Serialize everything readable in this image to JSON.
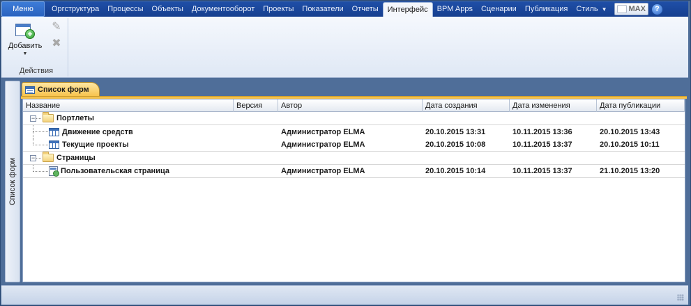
{
  "menubar": {
    "menu_label": "Меню",
    "tabs": [
      {
        "label": "Оргструктура"
      },
      {
        "label": "Процессы"
      },
      {
        "label": "Объекты"
      },
      {
        "label": "Документооборот"
      },
      {
        "label": "Проекты"
      },
      {
        "label": "Показатели"
      },
      {
        "label": "Отчеты"
      },
      {
        "label": "Интерфейс"
      },
      {
        "label": "BPM Apps"
      },
      {
        "label": "Сценарии"
      },
      {
        "label": "Публикация"
      },
      {
        "label": "Стиль"
      }
    ],
    "active_tab": "Интерфейс",
    "max_label": "MAX",
    "help_glyph": "?"
  },
  "ribbon": {
    "add_label": "Добавить",
    "group_label": "Действия"
  },
  "side_panel": {
    "label": "Список форм"
  },
  "document": {
    "tab_label": "Список форм"
  },
  "grid": {
    "columns": [
      "Название",
      "Версия",
      "Автор",
      "Дата создания",
      "Дата изменения",
      "Дата публикации"
    ],
    "groups": [
      {
        "name": "Портлеты",
        "items": [
          {
            "name": "Движение средств",
            "version": "",
            "author": "Администратор ELMA",
            "created": "20.10.2015 13:31",
            "modified": "10.11.2015 13:36",
            "published": "20.10.2015 13:43"
          },
          {
            "name": "Текущие проекты",
            "version": "",
            "author": "Администратор ELMA",
            "created": "20.10.2015 10:08",
            "modified": "10.11.2015 13:37",
            "published": "20.10.2015 10:11"
          }
        ]
      },
      {
        "name": "Страницы",
        "items": [
          {
            "name": "Пользовательская страница",
            "version": "",
            "author": "Администратор ELMA",
            "created": "20.10.2015 10:14",
            "modified": "10.11.2015 13:37",
            "published": "21.10.2015 13:20"
          }
        ]
      }
    ]
  },
  "colors": {
    "menubar": "#1f4fa8",
    "accent_tab": "#f7c24a",
    "frame": "#4f6e99"
  }
}
